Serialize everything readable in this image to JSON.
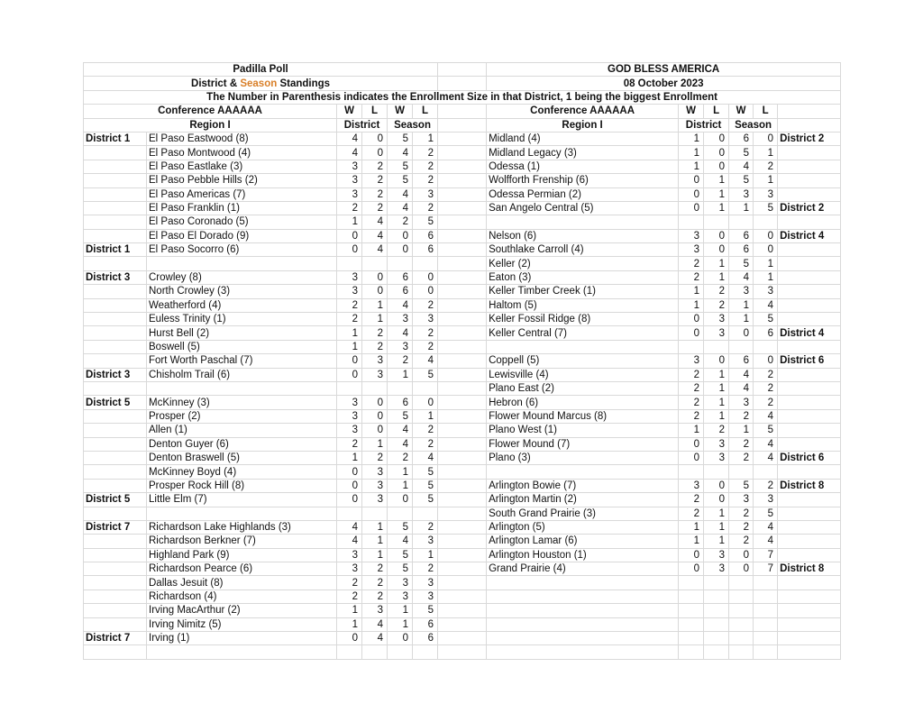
{
  "header": {
    "title_left": "Padilla Poll",
    "title_right": "GOD BLESS AMERICA",
    "subtitle_prefix": "District & ",
    "subtitle_season": "Season",
    "subtitle_suffix": " Standings",
    "date": "08 October 2023",
    "note": "The Number in Parenthesis indicates the Enrollment Size in that District, 1 being the biggest Enrollment"
  },
  "columns": {
    "conference": "Conference AAAAAA",
    "region": "Region I",
    "w": "W",
    "l": "L",
    "district": "District",
    "season": "Season"
  },
  "colors": {
    "red": "#e0141c",
    "orange": "#d9802a",
    "blue": "#1a1ac8",
    "purple": "#7b3fa0"
  },
  "left": [
    {
      "label": "District 1",
      "label_color": "black",
      "name": "El Paso Eastwood (8)",
      "dw": "4",
      "dl": "0",
      "sw": "5",
      "sl": "1"
    },
    {
      "label": "",
      "name": "El Paso Montwood (4)",
      "dw": "4",
      "dl": "0",
      "sw": "4",
      "sl": "2"
    },
    {
      "label": "",
      "name": "El Paso Eastlake (3)",
      "dw": "3",
      "dl": "2",
      "sw": "5",
      "sl": "2"
    },
    {
      "label": "",
      "name": "El Paso Pebble Hills (2)",
      "dw": "3",
      "dl": "2",
      "sw": "5",
      "sl": "2"
    },
    {
      "label": "",
      "name": "El Paso Americas (7)",
      "dw": "3",
      "dl": "2",
      "sw": "4",
      "sl": "3"
    },
    {
      "label": "",
      "name": "El Paso Franklin (1)",
      "dw": "2",
      "dl": "2",
      "sw": "4",
      "sl": "2"
    },
    {
      "label": "",
      "name": "El Paso Coronado (5)",
      "dw": "1",
      "dl": "4",
      "sw": "2",
      "sl": "5"
    },
    {
      "label": "",
      "name": "El Paso El Dorado (9)",
      "dw": "0",
      "dl": "4",
      "sw": "0",
      "sl": "6"
    },
    {
      "label": "District 1",
      "label_color": "black",
      "name": "El Paso Socorro (6)",
      "dw": "0",
      "dl": "4",
      "sw": "0",
      "sl": "6"
    },
    {
      "label": "",
      "name": "",
      "dw": "",
      "dl": "",
      "sw": "",
      "sl": ""
    },
    {
      "label": "District 3",
      "label_color": "red",
      "name": "Crowley (8)",
      "dw": "3",
      "dl": "0",
      "sw": "6",
      "sl": "0"
    },
    {
      "label": "",
      "name": "North Crowley (3)",
      "dw": "3",
      "dl": "0",
      "sw": "6",
      "sl": "0"
    },
    {
      "label": "",
      "name": "Weatherford (4)",
      "dw": "2",
      "dl": "1",
      "sw": "4",
      "sl": "2"
    },
    {
      "label": "",
      "name": "Euless Trinity (1)",
      "dw": "2",
      "dl": "1",
      "sw": "3",
      "sl": "3"
    },
    {
      "label": "",
      "name": "Hurst Bell (2)",
      "dw": "1",
      "dl": "2",
      "sw": "4",
      "sl": "2"
    },
    {
      "label": "",
      "name": "Boswell (5)",
      "dw": "1",
      "dl": "2",
      "sw": "3",
      "sl": "2"
    },
    {
      "label": "",
      "name": "Fort Worth Paschal (7)",
      "dw": "0",
      "dl": "3",
      "sw": "2",
      "sl": "4"
    },
    {
      "label": "District 3",
      "label_color": "red",
      "name": "Chisholm Trail (6)",
      "dw": "0",
      "dl": "3",
      "sw": "1",
      "sl": "5"
    },
    {
      "label": "",
      "name": "",
      "dw": "",
      "dl": "",
      "sw": "",
      "sl": ""
    },
    {
      "label": "District 5",
      "label_color": "black",
      "name": "McKinney (3)",
      "dw": "3",
      "dl": "0",
      "sw": "6",
      "sl": "0"
    },
    {
      "label": "",
      "name": "Prosper (2)",
      "dw": "3",
      "dl": "0",
      "sw": "5",
      "sl": "1"
    },
    {
      "label": "",
      "name": "Allen (1)",
      "dw": "3",
      "dl": "0",
      "sw": "4",
      "sl": "2"
    },
    {
      "label": "",
      "name": "Denton Guyer (6)",
      "dw": "2",
      "dl": "1",
      "sw": "4",
      "sl": "2"
    },
    {
      "label": "",
      "name": "Denton Braswell (5)",
      "dw": "1",
      "dl": "2",
      "sw": "2",
      "sl": "4"
    },
    {
      "label": "",
      "name": "McKinney Boyd (4)",
      "dw": "0",
      "dl": "3",
      "sw": "1",
      "sl": "5"
    },
    {
      "label": "",
      "name": "Prosper Rock Hill (8)",
      "dw": "0",
      "dl": "3",
      "sw": "1",
      "sl": "5"
    },
    {
      "label": "District 5",
      "label_color": "black",
      "name": "Little Elm (7)",
      "dw": "0",
      "dl": "3",
      "sw": "0",
      "sl": "5"
    },
    {
      "label": "",
      "name": "",
      "dw": "",
      "dl": "",
      "sw": "",
      "sl": ""
    },
    {
      "label": "District 7",
      "label_color": "red",
      "name": "Richardson Lake Highlands (3)",
      "dw": "4",
      "dl": "1",
      "sw": "5",
      "sl": "2"
    },
    {
      "label": "",
      "name": "Richardson Berkner (7)",
      "dw": "4",
      "dl": "1",
      "sw": "4",
      "sl": "3"
    },
    {
      "label": "",
      "name": "Highland Park (9)",
      "dw": "3",
      "dl": "1",
      "sw": "5",
      "sl": "1"
    },
    {
      "label": "",
      "name": "Richardson Pearce (6)",
      "dw": "3",
      "dl": "2",
      "sw": "5",
      "sl": "2"
    },
    {
      "label": "",
      "name": "Dallas Jesuit (8)",
      "dw": "2",
      "dl": "2",
      "sw": "3",
      "sl": "3"
    },
    {
      "label": "",
      "name": "Richardson (4)",
      "dw": "2",
      "dl": "2",
      "sw": "3",
      "sl": "3"
    },
    {
      "label": "",
      "name": "Irving MacArthur (2)",
      "dw": "1",
      "dl": "3",
      "sw": "1",
      "sl": "5"
    },
    {
      "label": "",
      "name": "Irving Nimitz (5)",
      "dw": "1",
      "dl": "4",
      "sw": "1",
      "sl": "6"
    },
    {
      "label": "District 7",
      "label_color": "red",
      "name": "Irving (1)",
      "dw": "0",
      "dl": "4",
      "sw": "0",
      "sl": "6"
    },
    {
      "label": "",
      "name": "",
      "dw": "",
      "dl": "",
      "sw": "",
      "sl": ""
    }
  ],
  "right": [
    {
      "name": "Midland (4)",
      "dw": "1",
      "dl": "0",
      "sw": "6",
      "sl": "0",
      "label": "District 2",
      "label_color": "blue"
    },
    {
      "name": "Midland Legacy (3)",
      "dw": "1",
      "dl": "0",
      "sw": "5",
      "sl": "1",
      "label": ""
    },
    {
      "name": "Odessa (1)",
      "dw": "1",
      "dl": "0",
      "sw": "4",
      "sl": "2",
      "label": ""
    },
    {
      "name": "Wolfforth Frenship (6)",
      "dw": "0",
      "dl": "1",
      "sw": "5",
      "sl": "1",
      "label": ""
    },
    {
      "name": "Odessa Permian (2)",
      "dw": "0",
      "dl": "1",
      "sw": "3",
      "sl": "3",
      "label": ""
    },
    {
      "name": "San Angelo Central (5)",
      "dw": "0",
      "dl": "1",
      "sw": "1",
      "sl": "5",
      "label": "District 2",
      "label_color": "blue"
    },
    {
      "name": "",
      "dw": "",
      "dl": "",
      "sw": "",
      "sl": "",
      "label": ""
    },
    {
      "name": "Nelson (6)",
      "dw": "3",
      "dl": "0",
      "sw": "6",
      "sl": "0",
      "label": "District 4",
      "label_color": "purple"
    },
    {
      "name": "Southlake Carroll (4)",
      "dw": "3",
      "dl": "0",
      "sw": "6",
      "sl": "0",
      "label": ""
    },
    {
      "name": "Keller (2)",
      "dw": "2",
      "dl": "1",
      "sw": "5",
      "sl": "1",
      "label": ""
    },
    {
      "name": "Eaton (3)",
      "dw": "2",
      "dl": "1",
      "sw": "4",
      "sl": "1",
      "label": ""
    },
    {
      "name": "Keller Timber Creek (1)",
      "dw": "1",
      "dl": "2",
      "sw": "3",
      "sl": "3",
      "label": ""
    },
    {
      "name": "Haltom (5)",
      "dw": "1",
      "dl": "2",
      "sw": "1",
      "sl": "4",
      "label": ""
    },
    {
      "name": "Keller Fossil Ridge (8)",
      "dw": "0",
      "dl": "3",
      "sw": "1",
      "sl": "5",
      "label": ""
    },
    {
      "name": "Keller Central (7)",
      "dw": "0",
      "dl": "3",
      "sw": "0",
      "sl": "6",
      "label": "District 4",
      "label_color": "purple"
    },
    {
      "name": "",
      "dw": "",
      "dl": "",
      "sw": "",
      "sl": "",
      "label": ""
    },
    {
      "name": "Coppell (5)",
      "dw": "3",
      "dl": "0",
      "sw": "6",
      "sl": "0",
      "label": "District 6",
      "label_color": "blue"
    },
    {
      "name": "Lewisville (4)",
      "dw": "2",
      "dl": "1",
      "sw": "4",
      "sl": "2",
      "label": ""
    },
    {
      "name": "Plano East (2)",
      "dw": "2",
      "dl": "1",
      "sw": "4",
      "sl": "2",
      "label": ""
    },
    {
      "name": "Hebron (6)",
      "dw": "2",
      "dl": "1",
      "sw": "3",
      "sl": "2",
      "label": ""
    },
    {
      "name": "Flower Mound Marcus (8)",
      "dw": "2",
      "dl": "1",
      "sw": "2",
      "sl": "4",
      "label": ""
    },
    {
      "name": "Plano West (1)",
      "dw": "1",
      "dl": "2",
      "sw": "1",
      "sl": "5",
      "label": ""
    },
    {
      "name": "Flower Mound (7)",
      "dw": "0",
      "dl": "3",
      "sw": "2",
      "sl": "4",
      "label": ""
    },
    {
      "name": "Plano (3)",
      "dw": "0",
      "dl": "3",
      "sw": "2",
      "sl": "4",
      "label": "District 6",
      "label_color": "blue"
    },
    {
      "name": "",
      "dw": "",
      "dl": "",
      "sw": "",
      "sl": "",
      "label": ""
    },
    {
      "name": "Arlington Bowie (7)",
      "dw": "3",
      "dl": "0",
      "sw": "5",
      "sl": "2",
      "label": "District 8",
      "label_color": "purple"
    },
    {
      "name": "Arlington Martin (2)",
      "dw": "2",
      "dl": "0",
      "sw": "3",
      "sl": "3",
      "label": ""
    },
    {
      "name": "South Grand Prairie (3)",
      "dw": "2",
      "dl": "1",
      "sw": "2",
      "sl": "5",
      "label": ""
    },
    {
      "name": "Arlington (5)",
      "dw": "1",
      "dl": "1",
      "sw": "2",
      "sl": "4",
      "label": ""
    },
    {
      "name": "Arlington Lamar (6)",
      "dw": "1",
      "dl": "1",
      "sw": "2",
      "sl": "4",
      "label": ""
    },
    {
      "name": "Arlington Houston (1)",
      "dw": "0",
      "dl": "3",
      "sw": "0",
      "sl": "7",
      "label": ""
    },
    {
      "name": "Grand Prairie (4)",
      "dw": "0",
      "dl": "3",
      "sw": "0",
      "sl": "7",
      "label": "District 8",
      "label_color": "purple"
    },
    {
      "name": "",
      "dw": "",
      "dl": "",
      "sw": "",
      "sl": "",
      "label": ""
    },
    {
      "name": "",
      "dw": "",
      "dl": "",
      "sw": "",
      "sl": "",
      "label": ""
    },
    {
      "name": "",
      "dw": "",
      "dl": "",
      "sw": "",
      "sl": "",
      "label": ""
    },
    {
      "name": "",
      "dw": "",
      "dl": "",
      "sw": "",
      "sl": "",
      "label": ""
    },
    {
      "name": "",
      "dw": "",
      "dl": "",
      "sw": "",
      "sl": "",
      "label": ""
    },
    {
      "name": "",
      "dw": "",
      "dl": "",
      "sw": "",
      "sl": "",
      "label": ""
    }
  ]
}
